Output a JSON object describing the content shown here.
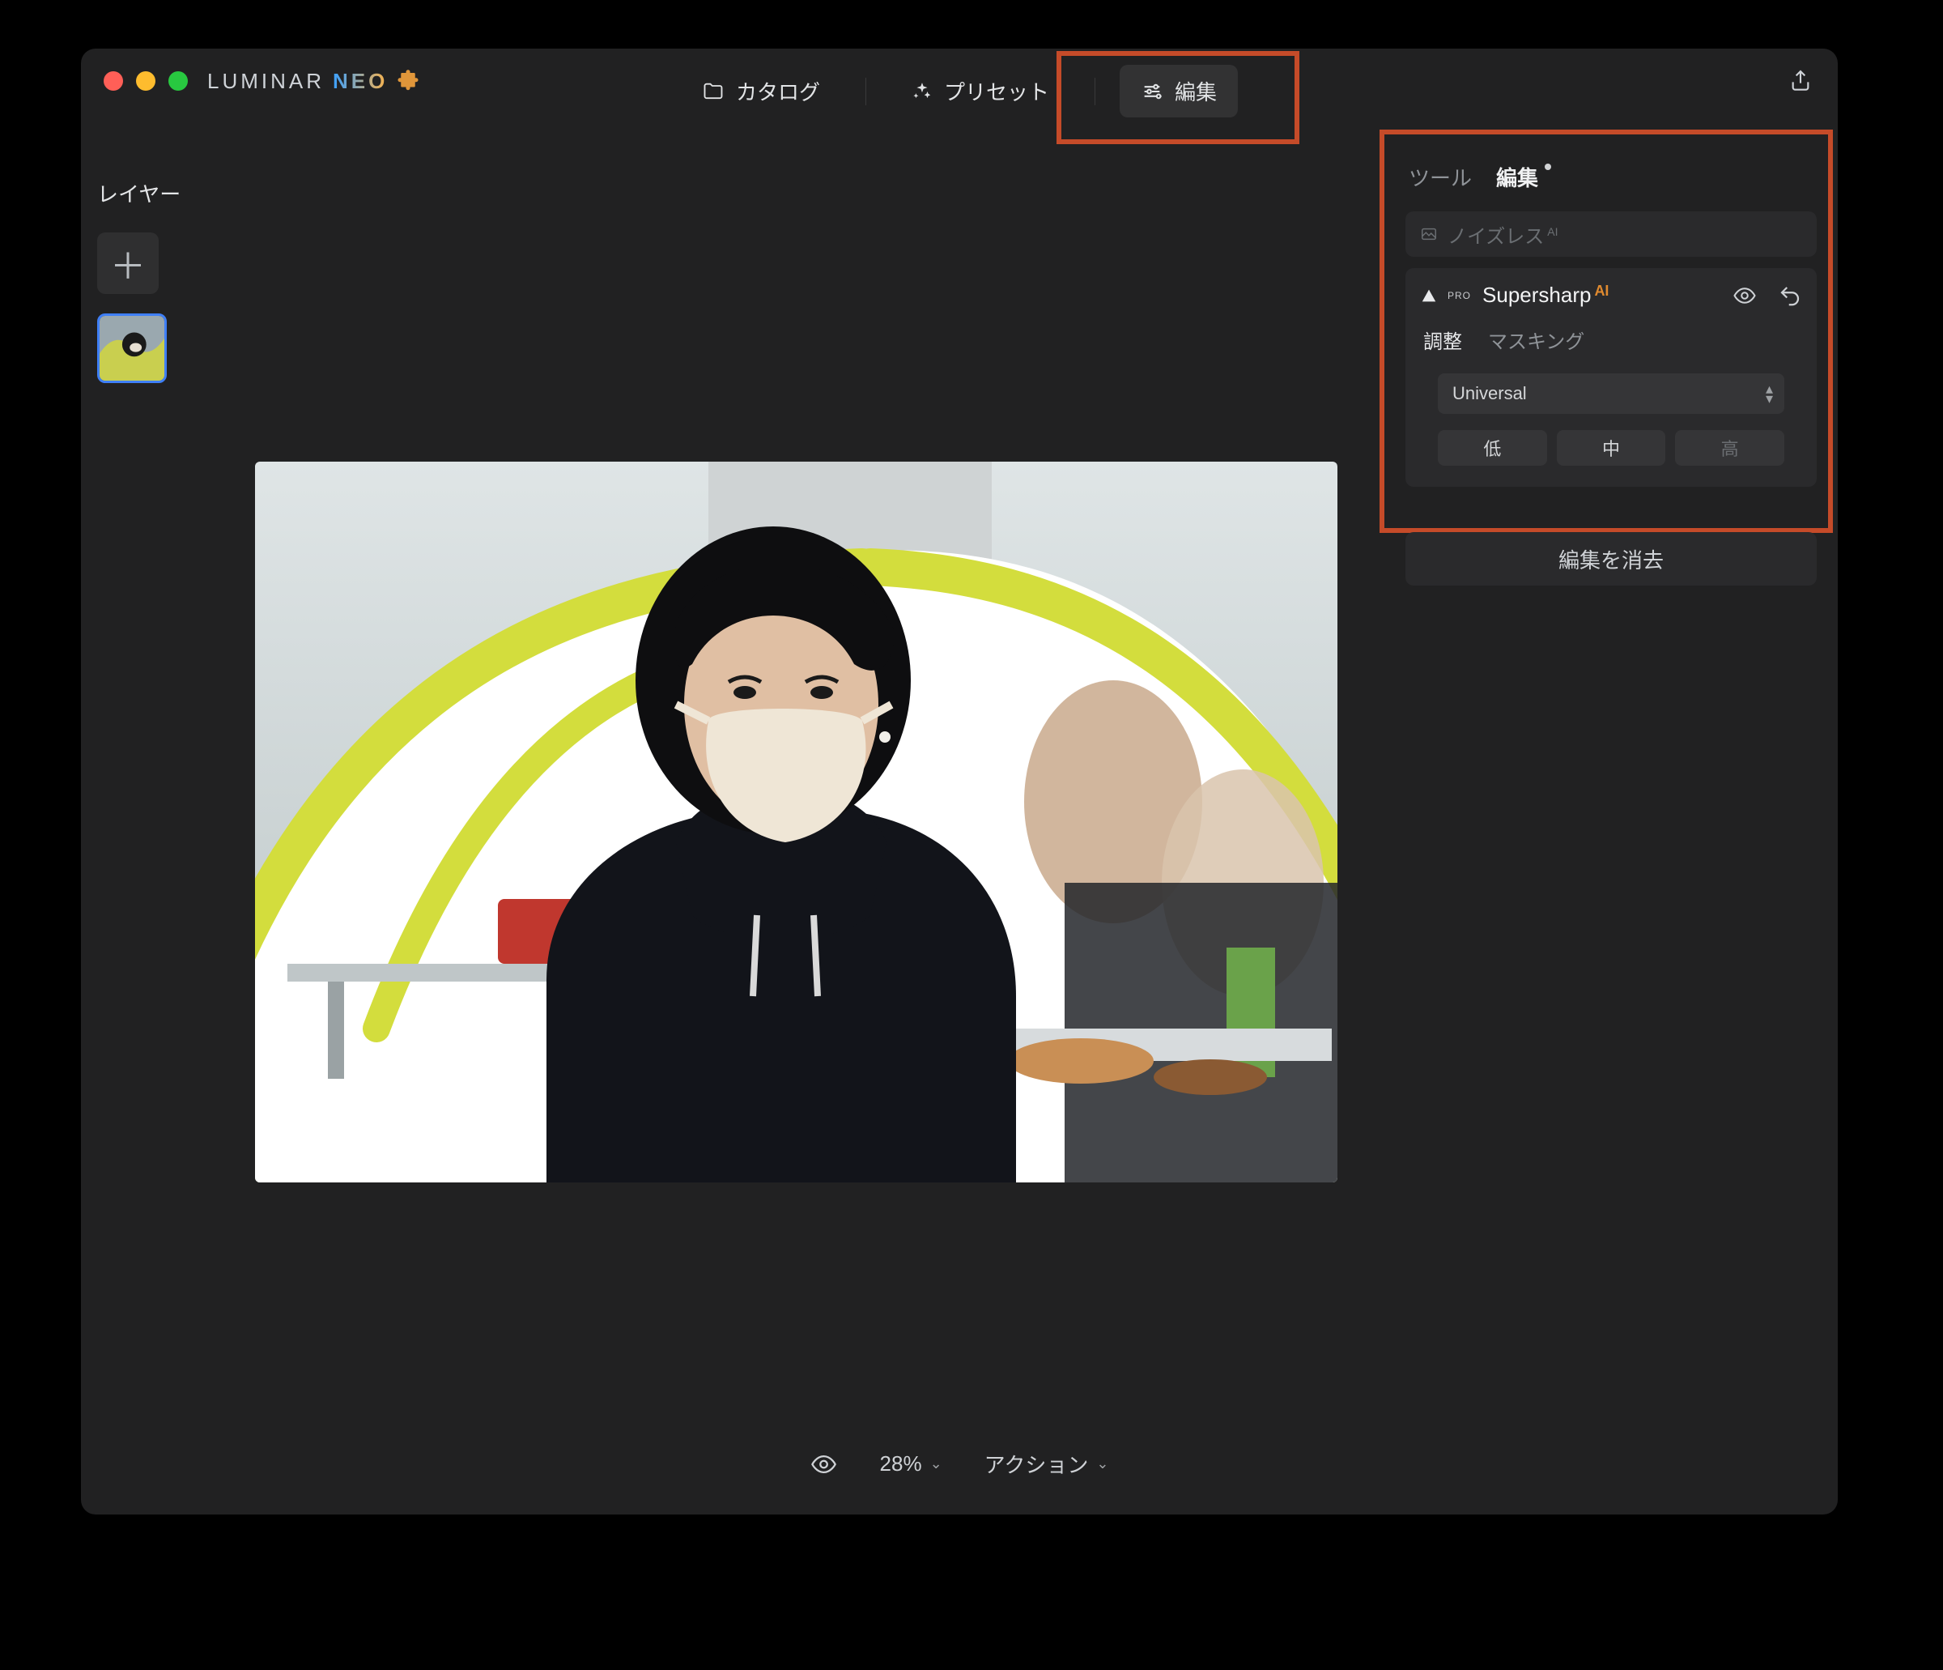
{
  "app": {
    "brand": "LUMINAR",
    "sub": "NEO"
  },
  "topnav": {
    "catalog": "カタログ",
    "presets": "プリセット",
    "edit": "編集"
  },
  "layers": {
    "title": "レイヤー"
  },
  "rightPanel": {
    "tabs": {
      "tools": "ツール",
      "edits": "編集"
    },
    "noisless": {
      "label": "ノイズレス",
      "ai": "AI"
    },
    "supersharp": {
      "label": "Supersharp",
      "ai": "AI",
      "pro": "PRO"
    },
    "subtabs": {
      "adjust": "調整",
      "masking": "マスキング"
    },
    "select": {
      "value": "Universal"
    },
    "strength": {
      "low": "低",
      "mid": "中",
      "high": "高"
    },
    "clear": "編集を消去"
  },
  "bottombar": {
    "zoom": "28%",
    "action": "アクション"
  }
}
